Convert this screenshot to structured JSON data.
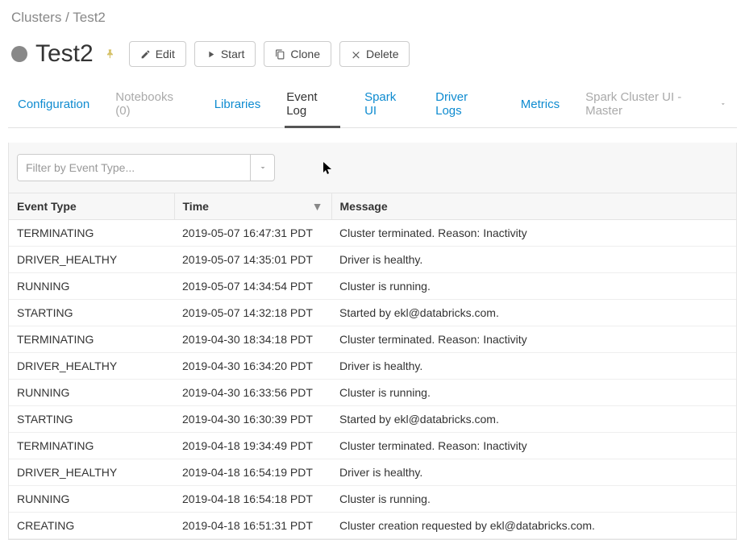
{
  "breadcrumb": {
    "root": "Clusters",
    "sep": " / ",
    "current": "Test2"
  },
  "cluster": {
    "name": "Test2"
  },
  "buttons": {
    "edit": "Edit",
    "start": "Start",
    "clone": "Clone",
    "delete": "Delete"
  },
  "tabs": {
    "configuration": "Configuration",
    "notebooks": "Notebooks (0)",
    "libraries": "Libraries",
    "eventlog": "Event Log",
    "sparkui": "Spark UI",
    "driverlogs": "Driver Logs",
    "metrics": "Metrics",
    "sparkclusterui": "Spark Cluster UI - Master"
  },
  "filter": {
    "placeholder": "Filter by Event Type..."
  },
  "columns": {
    "eventType": "Event Type",
    "time": "Time",
    "message": "Message"
  },
  "rows": [
    {
      "type": "TERMINATING",
      "time": "2019-05-07 16:47:31 PDT",
      "msg": "Cluster terminated. Reason: Inactivity"
    },
    {
      "type": "DRIVER_HEALTHY",
      "time": "2019-05-07 14:35:01 PDT",
      "msg": "Driver is healthy."
    },
    {
      "type": "RUNNING",
      "time": "2019-05-07 14:34:54 PDT",
      "msg": "Cluster is running."
    },
    {
      "type": "STARTING",
      "time": "2019-05-07 14:32:18 PDT",
      "msg": "Started by ekl@databricks.com."
    },
    {
      "type": "TERMINATING",
      "time": "2019-04-30 18:34:18 PDT",
      "msg": "Cluster terminated. Reason: Inactivity"
    },
    {
      "type": "DRIVER_HEALTHY",
      "time": "2019-04-30 16:34:20 PDT",
      "msg": "Driver is healthy."
    },
    {
      "type": "RUNNING",
      "time": "2019-04-30 16:33:56 PDT",
      "msg": "Cluster is running."
    },
    {
      "type": "STARTING",
      "time": "2019-04-30 16:30:39 PDT",
      "msg": "Started by ekl@databricks.com."
    },
    {
      "type": "TERMINATING",
      "time": "2019-04-18 19:34:49 PDT",
      "msg": "Cluster terminated. Reason: Inactivity"
    },
    {
      "type": "DRIVER_HEALTHY",
      "time": "2019-04-18 16:54:19 PDT",
      "msg": "Driver is healthy."
    },
    {
      "type": "RUNNING",
      "time": "2019-04-18 16:54:18 PDT",
      "msg": "Cluster is running."
    },
    {
      "type": "CREATING",
      "time": "2019-04-18 16:51:31 PDT",
      "msg": "Cluster creation requested by ekl@databricks.com."
    }
  ]
}
